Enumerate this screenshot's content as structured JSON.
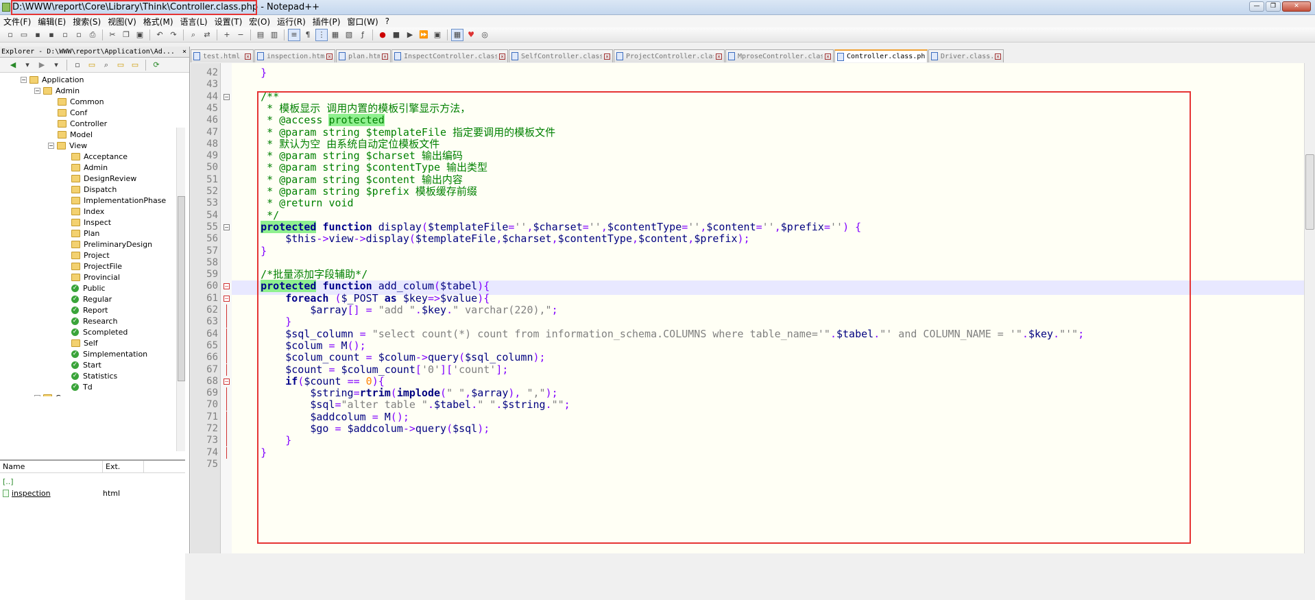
{
  "window": {
    "title": "D:\\WWW\\report\\Core\\Library\\Think\\Controller.class.php - Notepad++",
    "buttons": [
      "—",
      "❐",
      "✕"
    ]
  },
  "menu": [
    "文件(F)",
    "编辑(E)",
    "搜索(S)",
    "视图(V)",
    "格式(M)",
    "语言(L)",
    "设置(T)",
    "宏(O)",
    "运行(R)",
    "插件(P)",
    "窗口(W)",
    "?"
  ],
  "explorer": {
    "header": "Explorer - D:\\WWW\\report\\Application\\Ad...",
    "close": "×",
    "tree": [
      {
        "label": "Application",
        "type": "folder"
      },
      {
        "label": "Admin",
        "type": "folder"
      },
      {
        "label": "Common",
        "type": "folder"
      },
      {
        "label": "Conf",
        "type": "folder"
      },
      {
        "label": "Controller",
        "type": "folder"
      },
      {
        "label": "Model",
        "type": "folder"
      },
      {
        "label": "View",
        "type": "folder"
      },
      {
        "label": "Acceptance",
        "type": "folder"
      },
      {
        "label": "Admin",
        "type": "folder"
      },
      {
        "label": "DesignReview",
        "type": "folder"
      },
      {
        "label": "Dispatch",
        "type": "folder"
      },
      {
        "label": "ImplementationPhase",
        "type": "folder"
      },
      {
        "label": "Index",
        "type": "folder"
      },
      {
        "label": "Inspect",
        "type": "folder"
      },
      {
        "label": "Plan",
        "type": "folder"
      },
      {
        "label": "PreliminaryDesign",
        "type": "folder"
      },
      {
        "label": "Project",
        "type": "folder"
      },
      {
        "label": "ProjectFile",
        "type": "folder"
      },
      {
        "label": "Provincial",
        "type": "folder"
      },
      {
        "label": "Public",
        "type": "ok"
      },
      {
        "label": "Regular",
        "type": "ok"
      },
      {
        "label": "Report",
        "type": "ok"
      },
      {
        "label": "Research",
        "type": "ok"
      },
      {
        "label": "Scompleted",
        "type": "ok"
      },
      {
        "label": "Self",
        "type": "folder"
      },
      {
        "label": "Simplementation",
        "type": "ok"
      },
      {
        "label": "Start",
        "type": "ok"
      },
      {
        "label": "Statistics",
        "type": "ok"
      },
      {
        "label": "Td",
        "type": "ok"
      },
      {
        "label": "Common",
        "type": "folder"
      }
    ],
    "files": {
      "col_name": "Name",
      "col_ext": "Ext.",
      "rows": [
        {
          "name": "[..]",
          "ext": ""
        },
        {
          "name": "inspection",
          "ext": "html"
        }
      ]
    }
  },
  "tabs": [
    {
      "label": "test.html",
      "active": false
    },
    {
      "label": "inspection.html",
      "active": false
    },
    {
      "label": "plan.html",
      "active": false
    },
    {
      "label": "InspectController.class.php",
      "active": false
    },
    {
      "label": "SelfController.class.php",
      "active": false
    },
    {
      "label": "ProjectController.class.php",
      "active": false
    },
    {
      "label": "MproseController.class.php",
      "active": false
    },
    {
      "label": "Controller.class.php",
      "active": true
    },
    {
      "label": "Driver.class.php",
      "active": false
    }
  ],
  "editor": {
    "current_line": "60",
    "lines": [
      {
        "n": "42",
        "t": "    }"
      },
      {
        "n": "43",
        "t": ""
      },
      {
        "n": "44",
        "t": "    /**"
      },
      {
        "n": "45",
        "t": "     * 模板显示 调用内置的模板引擎显示方法，"
      },
      {
        "n": "46",
        "t": "     * @access protected"
      },
      {
        "n": "47",
        "t": "     * @param string $templateFile 指定要调用的模板文件"
      },
      {
        "n": "48",
        "t": "     * 默认为空 由系统自动定位模板文件"
      },
      {
        "n": "49",
        "t": "     * @param string $charset 输出编码"
      },
      {
        "n": "50",
        "t": "     * @param string $contentType 输出类型"
      },
      {
        "n": "51",
        "t": "     * @param string $content 输出内容"
      },
      {
        "n": "52",
        "t": "     * @param string $prefix 模板缓存前缀"
      },
      {
        "n": "53",
        "t": "     * @return void"
      },
      {
        "n": "54",
        "t": "     */"
      },
      {
        "n": "55",
        "t": "    protected function display($templateFile='',$charset='',$contentType='',$content='',$prefix='') {"
      },
      {
        "n": "56",
        "t": "        $this->view->display($templateFile,$charset,$contentType,$content,$prefix);"
      },
      {
        "n": "57",
        "t": "    }"
      },
      {
        "n": "58",
        "t": ""
      },
      {
        "n": "59",
        "t": "    /*批量添加字段辅助*/"
      },
      {
        "n": "60",
        "t": "    protected function add_colum($tabel){"
      },
      {
        "n": "61",
        "t": "        foreach ($_POST as $key=>$value){"
      },
      {
        "n": "62",
        "t": "            $array[] = \"add \".$key.\" varchar(220),\";"
      },
      {
        "n": "63",
        "t": "        }"
      },
      {
        "n": "64",
        "t": "        $sql_column = \"select count(*) count from information_schema.COLUMNS where table_name='\".$tabel.\"' and COLUMN_NAME = '\".$key.\"'\";"
      },
      {
        "n": "65",
        "t": "        $colum = M();"
      },
      {
        "n": "66",
        "t": "        $colum_count = $colum->query($sql_column);"
      },
      {
        "n": "67",
        "t": "        $count = $colum_count['0']['count'];"
      },
      {
        "n": "68",
        "t": "        if($count == 0){"
      },
      {
        "n": "69",
        "t": "            $string=rtrim(implode(\" \",$array), \",\");"
      },
      {
        "n": "70",
        "t": "            $sql=\"alter table \".$tabel.\" \".$string.\"\";"
      },
      {
        "n": "71",
        "t": "            $addcolum = M();"
      },
      {
        "n": "72",
        "t": "            $go = $addcolum->query($sql);"
      },
      {
        "n": "73",
        "t": "        }"
      },
      {
        "n": "74",
        "t": "    }"
      },
      {
        "n": "75",
        "t": ""
      }
    ]
  },
  "colors": {
    "comment": "#008000",
    "keyword": "#00008b",
    "highlight": "#8ff08f",
    "string": "#808080",
    "number": "#ff8000",
    "operator": "#8000ff",
    "annotation_box": "#e53333"
  }
}
